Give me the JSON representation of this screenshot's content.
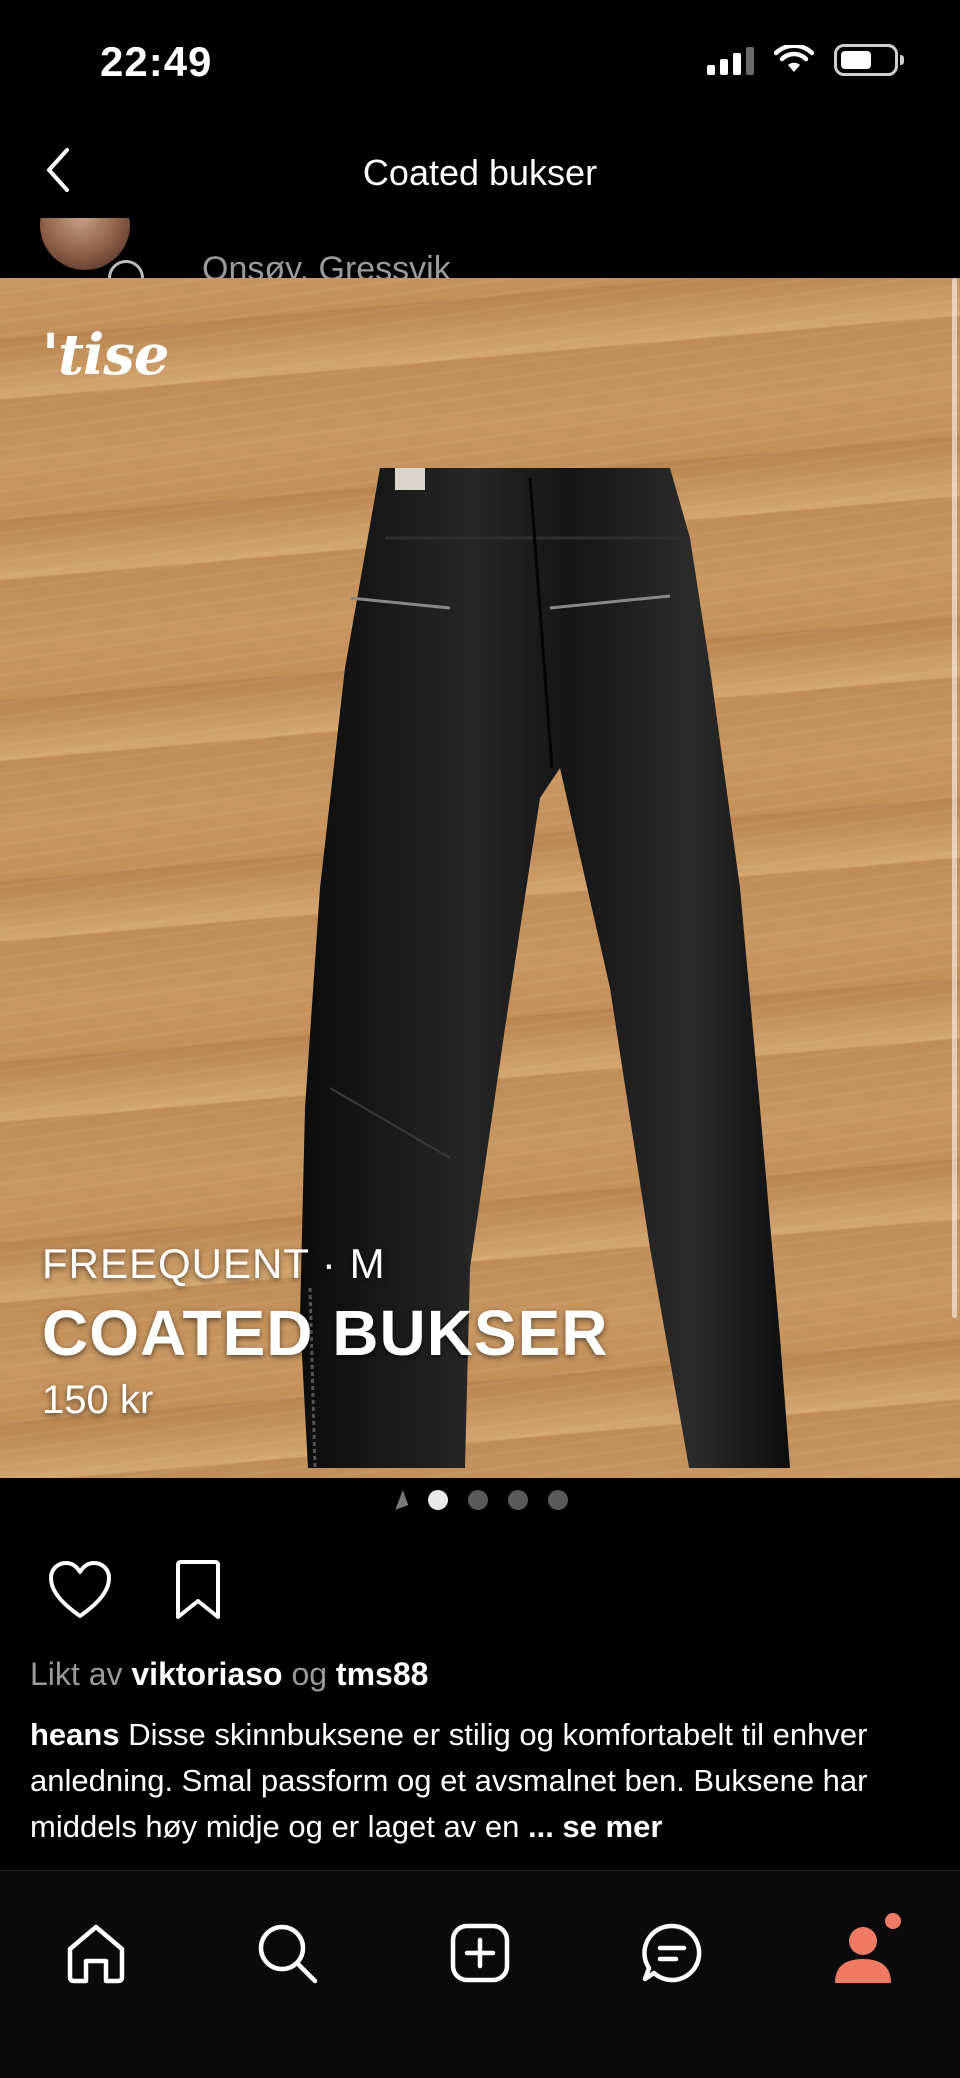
{
  "status_bar": {
    "time": "22:49"
  },
  "header": {
    "title": "Coated bukser",
    "seller_location": "Onsøy, Gressvik"
  },
  "photo": {
    "logo": "'tise",
    "overlay": {
      "brand_size": "FREEQUENT · M",
      "title": "COATED BUKSER",
      "price": "150 kr"
    },
    "pagination": {
      "total": 4,
      "active_index": 0
    }
  },
  "likes": {
    "prefix": "Likt av",
    "user1": "viktoriaso",
    "joiner": "og",
    "user2": "tms88"
  },
  "description": {
    "username": "heans",
    "text": "Disse skinnbuksene er stilig og komfortabelt til enhver anledning. Smal passform og et avsmalnet ben. Buksene har middels høy midje og er laget av en",
    "more_label": "... se mer"
  },
  "colors": {
    "accent_profile": "#f07a63",
    "background": "#000000"
  },
  "icons": {
    "actions": [
      "heart-icon",
      "bookmark-icon"
    ],
    "nav": [
      "home-icon",
      "search-icon",
      "add-listing-icon",
      "messages-icon",
      "profile-icon"
    ]
  }
}
